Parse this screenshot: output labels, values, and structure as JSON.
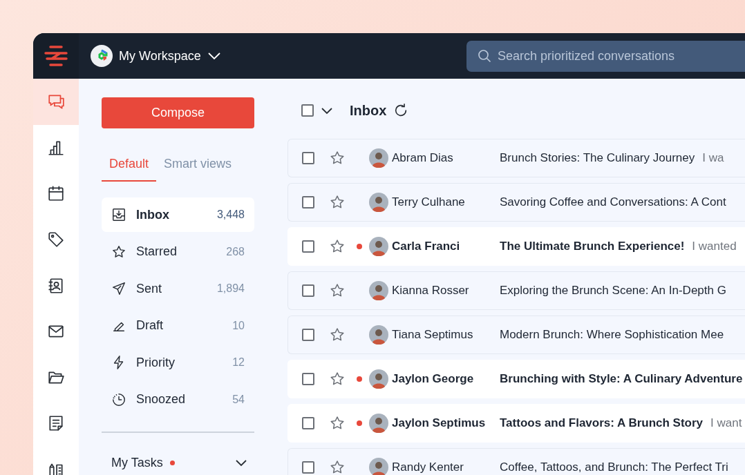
{
  "header": {
    "workspace": "My Workspace",
    "search": {
      "placeholder": "Search prioritized conversations"
    }
  },
  "rail": [
    {
      "kind": "chat",
      "selected": true
    },
    {
      "kind": "chart",
      "selected": false
    },
    {
      "kind": "calendar",
      "selected": false
    },
    {
      "kind": "tag",
      "selected": false
    },
    {
      "kind": "contacts",
      "selected": false
    },
    {
      "kind": "mail",
      "selected": false
    },
    {
      "kind": "folder",
      "selected": false
    },
    {
      "kind": "note",
      "selected": false
    },
    {
      "kind": "books",
      "selected": false
    }
  ],
  "compose": "Compose",
  "view_tabs": [
    {
      "label": "Default",
      "selected": true
    },
    {
      "label": "Smart views",
      "selected": false
    }
  ],
  "folders": [
    {
      "kind": "inbox",
      "label": "Inbox",
      "count": "3,448",
      "selected": true
    },
    {
      "kind": "star",
      "label": "Starred",
      "count": "268",
      "selected": false
    },
    {
      "kind": "send",
      "label": "Sent",
      "count": "1,894",
      "selected": false
    },
    {
      "kind": "pencil",
      "label": "Draft",
      "count": "10",
      "selected": false
    },
    {
      "kind": "bolt",
      "label": "Priority",
      "count": "12",
      "selected": false
    },
    {
      "kind": "clock",
      "label": "Snoozed",
      "count": "54",
      "selected": false
    }
  ],
  "my_tasks": {
    "label": "My Tasks",
    "unread": true,
    "expanded": false
  },
  "list": {
    "title": "Inbox",
    "all_checked": false,
    "rows": [
      {
        "sender": "Abram Dias",
        "subject": "Brunch Stories: The Culinary Journey",
        "preview": "I wa",
        "unread": false,
        "checked": false,
        "starred": false
      },
      {
        "sender": "Terry Culhane",
        "subject": "Savoring Coffee and Conversations: A Cont",
        "unread": false,
        "checked": false,
        "starred": false
      },
      {
        "sender": "Carla Franci",
        "subject": "The Ultimate Brunch Experience!",
        "preview": "I wanted",
        "unread": true,
        "checked": false,
        "starred": false
      },
      {
        "sender": "Kianna Rosser",
        "subject": "Exploring the Brunch Scene: An In-Depth G",
        "unread": false,
        "checked": false,
        "starred": false
      },
      {
        "sender": "Tiana Septimus",
        "subject": "Modern Brunch: Where Sophistication Mee",
        "unread": false,
        "checked": false,
        "starred": false
      },
      {
        "sender": "Jaylon George",
        "subject": "Brunching with Style: A Culinary Adventure",
        "unread": true,
        "checked": false,
        "starred": false
      },
      {
        "sender": "Jaylon Septimus",
        "subject": "Tattoos and Flavors: A Brunch Story",
        "preview": "I want",
        "unread": true,
        "checked": false,
        "starred": false
      },
      {
        "sender": "Randy Kenter",
        "subject": "Coffee, Tattoos, and Brunch: The Perfect Tri",
        "unread": false,
        "checked": false,
        "starred": false
      }
    ]
  }
}
